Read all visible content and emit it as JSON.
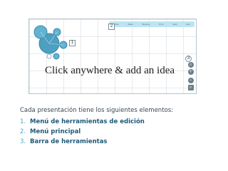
{
  "screenshot": {
    "topbar": {
      "items": [
        "Undo",
        "Redo",
        "Meeting",
        "Print",
        "Help",
        "Exit"
      ]
    },
    "markers": [
      "1",
      "2",
      "3"
    ],
    "canvas_prompt": "Click anywhere & add an idea",
    "zoom": {
      "in": "+",
      "out": "−",
      "home": "⌂"
    }
  },
  "caption": "Cada presentación tiene los siguientes elementos:",
  "list": [
    {
      "num": "1.",
      "label": "Menú de herramientas de edición"
    },
    {
      "num": "2.",
      "label": "Menú principal"
    },
    {
      "num": "3.",
      "label": "Barra de herramientas"
    }
  ]
}
